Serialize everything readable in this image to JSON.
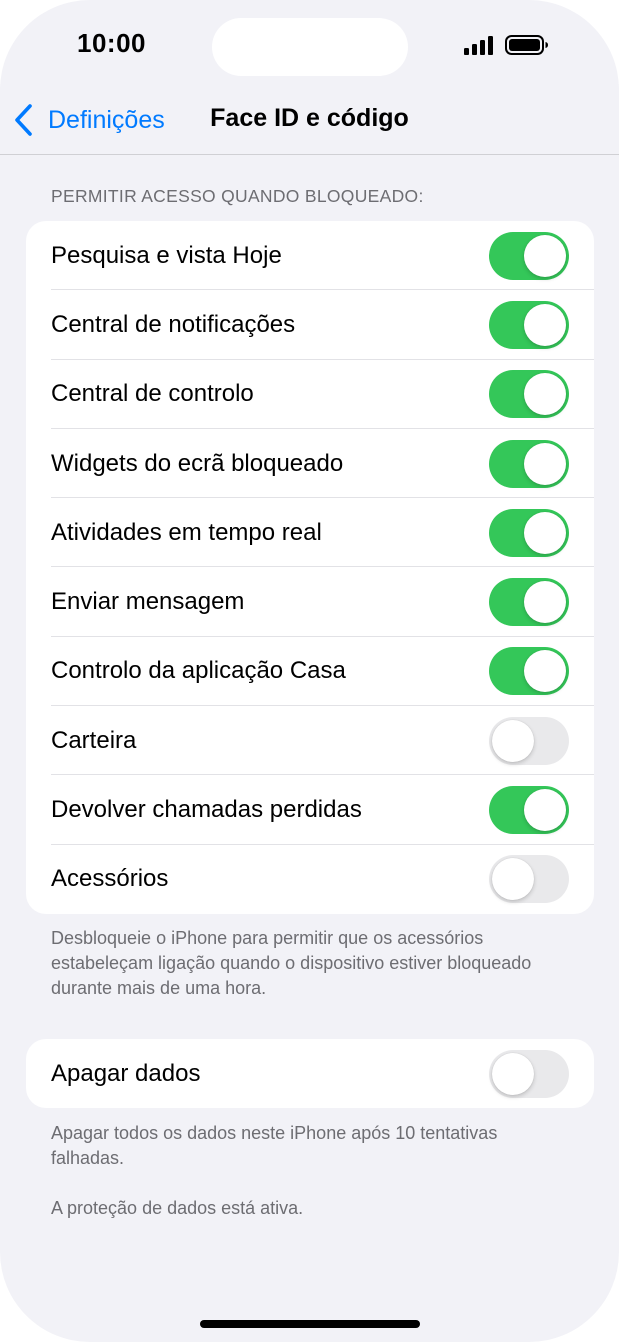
{
  "status_bar": {
    "time": "10:00",
    "icons": [
      "signal-icon",
      "battery-icon"
    ]
  },
  "nav": {
    "back_label": "Definições",
    "title": "Face ID e código",
    "back_icon": "chevron-left-icon"
  },
  "locked_access": {
    "header": "PERMITIR ACESSO QUANDO BLOQUEADO:",
    "items": [
      {
        "label": "Pesquisa e vista Hoje",
        "on": true
      },
      {
        "label": "Central de notificações",
        "on": true
      },
      {
        "label": "Central de controlo",
        "on": true
      },
      {
        "label": "Widgets do ecrã bloqueado",
        "on": true
      },
      {
        "label": "Atividades em tempo real",
        "on": true
      },
      {
        "label": "Enviar mensagem",
        "on": true
      },
      {
        "label": "Controlo da aplicação Casa",
        "on": true
      },
      {
        "label": "Carteira",
        "on": false
      },
      {
        "label": "Devolver chamadas perdidas",
        "on": true
      },
      {
        "label": "Acessórios",
        "on": false
      }
    ],
    "footer": "Desbloqueie o iPhone para permitir que os acessórios estabeleçam ligação quando o dispositivo estiver bloqueado durante mais de uma hora."
  },
  "erase": {
    "label": "Apagar dados",
    "on": false,
    "footer": "Apagar todos os dados neste iPhone após 10 tentativas falhadas.",
    "note": "A proteção de dados está ativa."
  },
  "colors": {
    "accent": "#007aff",
    "toggle_on": "#34c759",
    "toggle_off": "#e9e9eb",
    "background": "#f2f2f7"
  }
}
